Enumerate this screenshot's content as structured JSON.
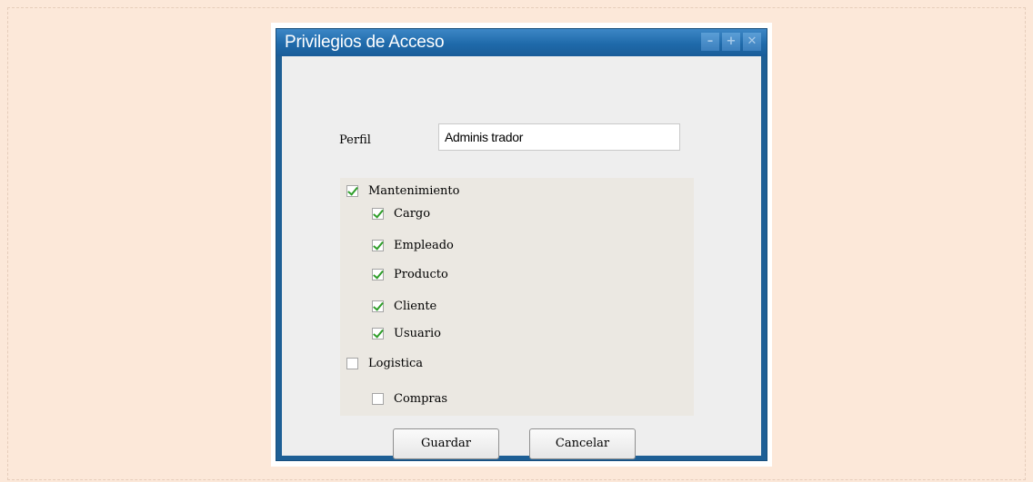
{
  "window": {
    "title": "Privilegios de Acceso",
    "controls": {
      "minimize": "–",
      "maximize": "+",
      "close": "✕"
    }
  },
  "form": {
    "perfil_label": "Perfil",
    "perfil_value": "Adminis trador"
  },
  "tree": {
    "mantenimiento": {
      "label": "Mantenimiento",
      "checked": true
    },
    "cargo": {
      "label": "Cargo",
      "checked": true
    },
    "empleado": {
      "label": "Empleado",
      "checked": true
    },
    "producto": {
      "label": "Producto",
      "checked": true
    },
    "cliente": {
      "label": "Cliente",
      "checked": true
    },
    "usuario": {
      "label": "Usuario",
      "checked": true
    },
    "logistica": {
      "label": "Logistica",
      "checked": false
    },
    "compras": {
      "label": "Compras",
      "checked": false
    }
  },
  "buttons": {
    "save": "Guardar",
    "cancel": "Cancelar"
  }
}
